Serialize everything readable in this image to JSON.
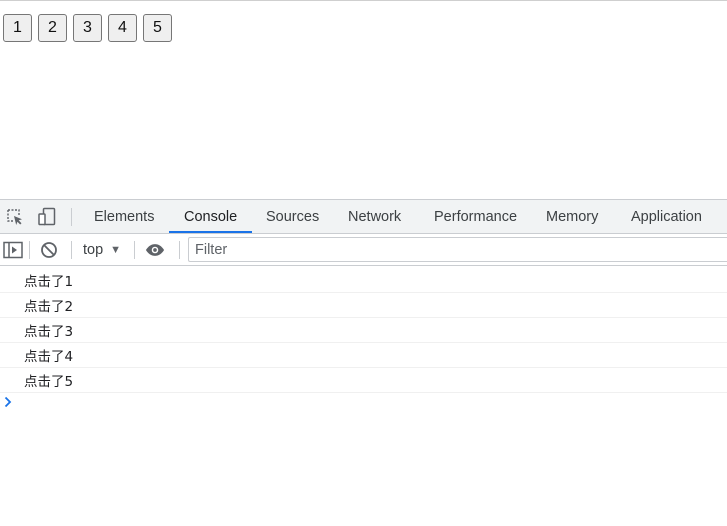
{
  "page": {
    "buttons": [
      "1",
      "2",
      "3",
      "4",
      "5"
    ]
  },
  "devtools": {
    "tabs": [
      {
        "label": "Elements",
        "active": false
      },
      {
        "label": "Console",
        "active": true
      },
      {
        "label": "Sources",
        "active": false
      },
      {
        "label": "Network",
        "active": false
      },
      {
        "label": "Performance",
        "active": false
      },
      {
        "label": "Memory",
        "active": false
      },
      {
        "label": "Application",
        "active": false
      }
    ],
    "toolbar": {
      "context": "top",
      "filter_placeholder": "Filter",
      "filter_value": ""
    },
    "console_messages": [
      "点击了1",
      "点击了2",
      "点击了3",
      "点击了4",
      "点击了5"
    ],
    "icons": {
      "inspect": "inspect-element-icon",
      "device": "device-toolbar-icon",
      "sidebar": "show-console-sidebar-icon",
      "clear": "clear-console-icon",
      "eye": "live-expression-icon",
      "prompt": "console-prompt-icon"
    },
    "colors": {
      "accent": "#1a73e8",
      "tabbar_bg": "#f1f3f4"
    }
  }
}
